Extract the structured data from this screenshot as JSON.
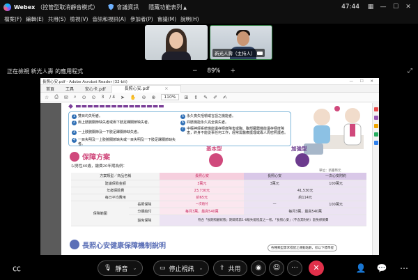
{
  "titlebar": {
    "app_name": "Webex",
    "mode": "（控管型取消靜音模式）",
    "meeting_info": "會議資訊",
    "hidden_menu": "隱藏功能表列",
    "time": "47:44"
  },
  "menubar": {
    "items": [
      "檔案(F)",
      "編輯(E)",
      "共用(S)",
      "檢視(V)",
      "音訊和視訊(A)",
      "參加者(P)",
      "會議(M)",
      "說明(H)"
    ]
  },
  "participants": {
    "host_name": "新光人壽（主持人）"
  },
  "viewbar": {
    "viewing_text": "正在檢視 新光人壽 的應用程式",
    "zoom_minus": "−",
    "zoom_level": "89%",
    "zoom_plus": "+"
  },
  "acrobat": {
    "window_title": "長照心安.pdf - Adobe Acrobat Reader (32-bit)",
    "tabs": [
      "首頁",
      "工具",
      "安心卡.pdf",
      "長照心安.pdf"
    ],
    "page_current": "3",
    "page_total": "/ 4",
    "zoom": "110%"
  },
  "pdf": {
    "conditions": [
      "雙目均失明者。",
      "兩上肢腕關節缺失者或兩下肢足踝關節缺失者。",
      "一上肢腕關節及一下肢足踝關節缺失者。",
      "一目失明及一上肢腕關節缺失或一目失明及一下肢足踝關節缺失者。",
      "永久喪失咀嚼或言語之機能者。",
      "四肢機能永久完全喪失者。",
      "中樞神經系統機能遺存極度障害或胸、腹部臟器機能遺存極度障害，終身不能從事任何工作，經常需醫療護理或專人周密照護者。"
    ],
    "plan_title": "保障方案",
    "plan_sub": "以男性40歲，繳費20年期為例：",
    "basic_label": "基本型",
    "adv_label": "加強型",
    "unit": "單位：新臺幣元",
    "table": {
      "r0": [
        "方案類型／商品名稱",
        "長照心安",
        "長照心安",
        "一次心安附約"
      ],
      "r1": [
        "建議保險金額",
        "3萬元",
        "3萬元",
        "100萬元"
      ],
      "r2": [
        "年繳保險費",
        "23,730元",
        "41,530元"
      ],
      "r3": [
        "每日平均費用",
        "約65元",
        "約114元"
      ],
      "r4": [
        "保障範圍",
        "長照保障",
        "一次給付",
        "—",
        "100萬元"
      ],
      "r5": [
        "分期給付",
        "每月3萬，最高540萬",
        "每月3萬，最高540萬"
      ],
      "r6": [
        "豁免保障",
        "符合「長期照顧狀態」期間或第1-6級失能程度之一者，「長照心安」（不含其附約）豁免保險費"
      ]
    },
    "sec2_title": "長照心安健康保障機制說明",
    "sec2_note": "各種類型需求搭配之運動點數，綜以下標準提"
  },
  "controls": {
    "mute": "靜音",
    "stop_video": "停止視訊",
    "share": "共用"
  },
  "colors": {
    "accent_pink": "#d0497c",
    "accent_purple": "#6c3b8e",
    "end_call_red": "#e0304a"
  }
}
